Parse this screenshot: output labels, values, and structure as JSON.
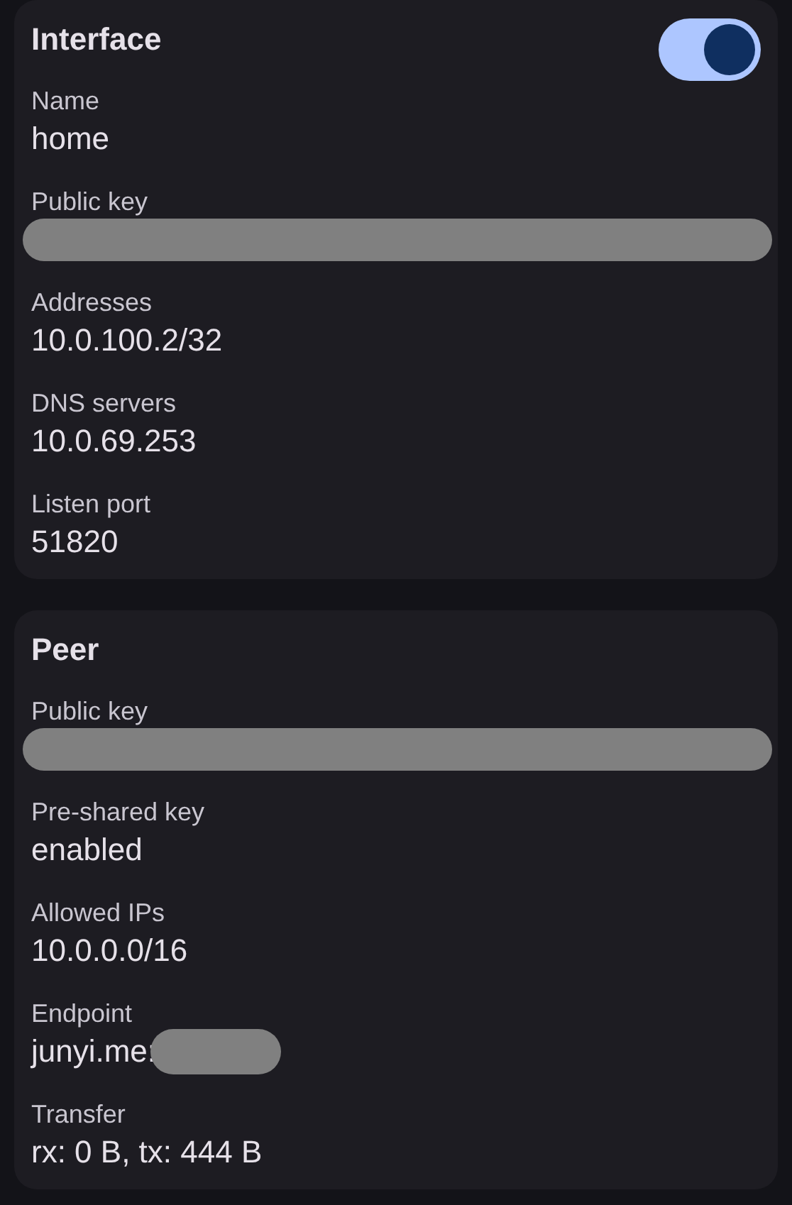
{
  "sections": [
    {
      "title": "Interface",
      "toggle": {
        "on": true
      },
      "fields": [
        {
          "label": "Name",
          "kind": "text",
          "value": "home"
        },
        {
          "label": "Public key",
          "kind": "redacted"
        },
        {
          "label": "Addresses",
          "kind": "text",
          "value": "10.0.100.2/32"
        },
        {
          "label": "DNS servers",
          "kind": "text",
          "value": "10.0.69.253"
        },
        {
          "label": "Listen port",
          "kind": "text",
          "value": "51820"
        }
      ]
    },
    {
      "title": "Peer",
      "fields": [
        {
          "label": "Public key",
          "kind": "redacted"
        },
        {
          "label": "Pre-shared key",
          "kind": "text",
          "value": "enabled"
        },
        {
          "label": "Allowed IPs",
          "kind": "text",
          "value": "10.0.0.0/16"
        },
        {
          "label": "Endpoint",
          "kind": "partly_redacted",
          "value": "junyi.me:"
        },
        {
          "label": "Transfer",
          "kind": "text",
          "value": "rx: 0 B, tx: 444 B"
        }
      ]
    }
  ]
}
